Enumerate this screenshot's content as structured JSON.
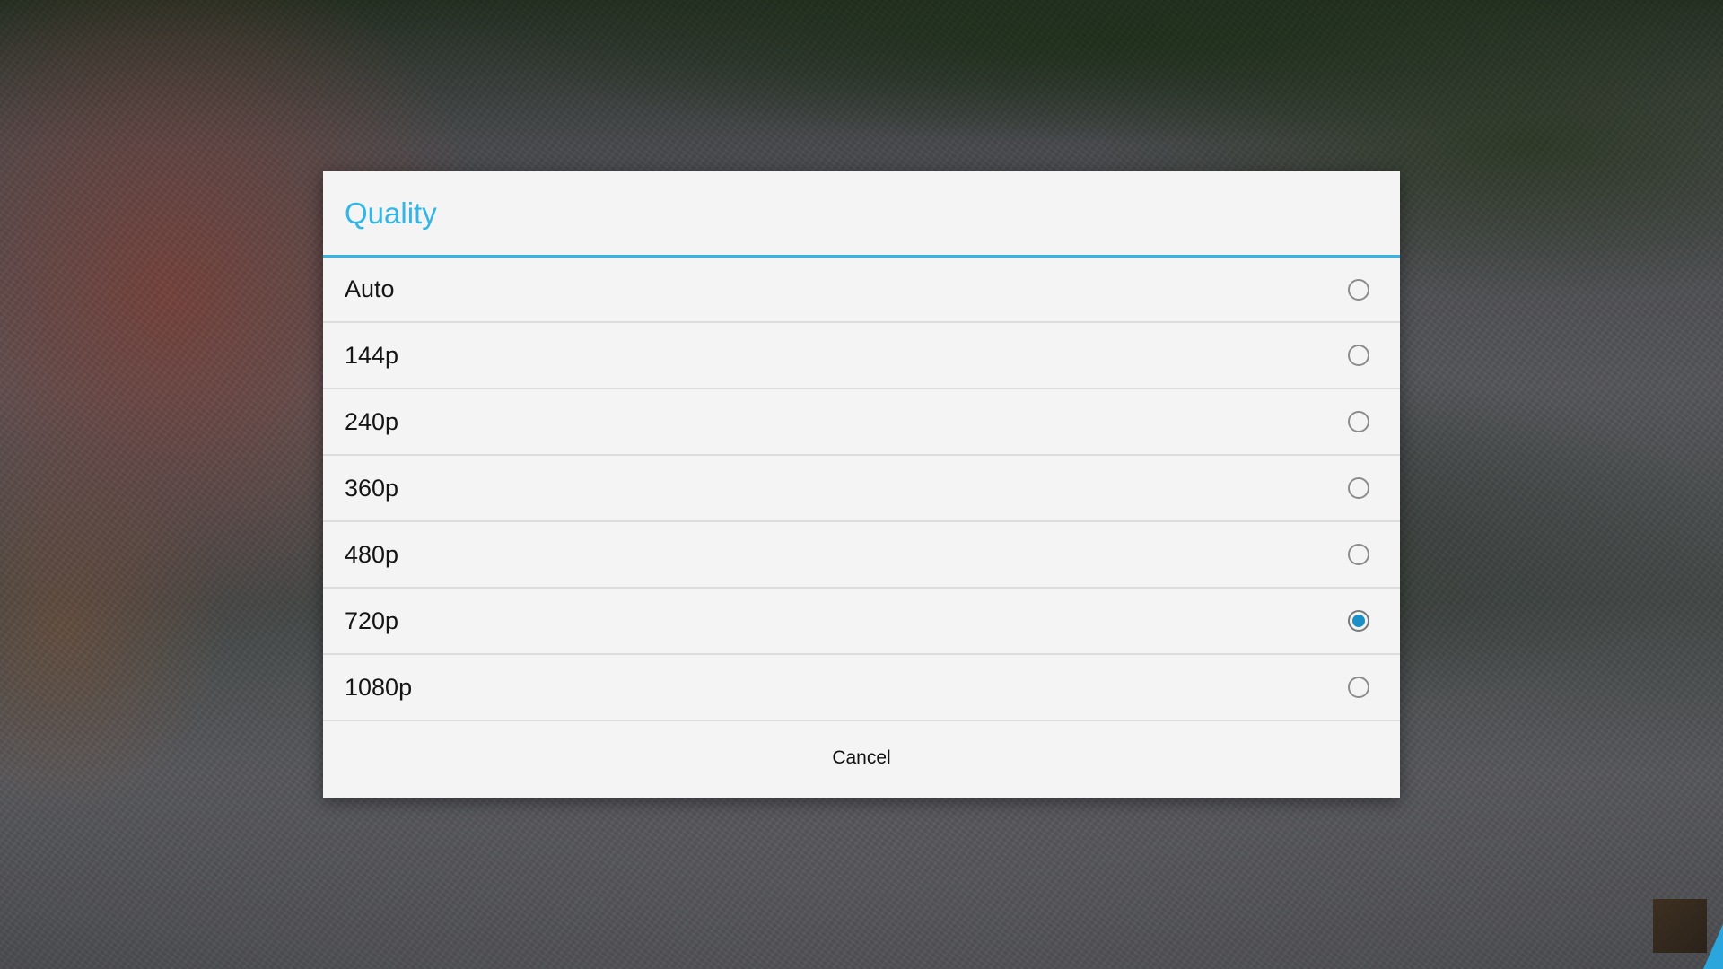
{
  "dialog": {
    "title": "Quality",
    "accent_color": "#33b5e5",
    "selected_color": "#1b8fc7",
    "options": [
      {
        "label": "Auto",
        "selected": false
      },
      {
        "label": "144p",
        "selected": false
      },
      {
        "label": "240p",
        "selected": false
      },
      {
        "label": "360p",
        "selected": false
      },
      {
        "label": "480p",
        "selected": false
      },
      {
        "label": "720p",
        "selected": true
      },
      {
        "label": "1080p",
        "selected": false
      }
    ],
    "cancel_label": "Cancel"
  }
}
